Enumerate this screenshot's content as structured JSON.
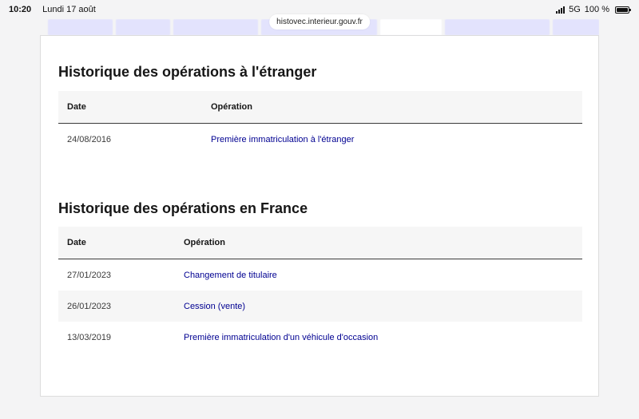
{
  "status_bar": {
    "time": "10:20",
    "date": "Lundi 17 août",
    "network": "5G",
    "battery": "100 %"
  },
  "browser": {
    "url": "histovec.interieur.gouv.fr"
  },
  "section_foreign": {
    "title": "Historique des opérations à l'étranger",
    "headers": {
      "date": "Date",
      "operation": "Opération"
    },
    "rows": [
      {
        "date": "24/08/2016",
        "operation": "Première immatriculation à l'étranger"
      }
    ]
  },
  "section_france": {
    "title": "Historique des opérations en France",
    "headers": {
      "date": "Date",
      "operation": "Opération"
    },
    "rows": [
      {
        "date": "27/01/2023",
        "operation": "Changement de titulaire"
      },
      {
        "date": "26/01/2023",
        "operation": "Cession (vente)"
      },
      {
        "date": "13/03/2019",
        "operation": "Première immatriculation d'un véhicule d'occasion"
      }
    ]
  },
  "colors": {
    "link": "#000091",
    "header_bg": "#f6f6f6",
    "tab_bg": "#e3e3fd"
  }
}
